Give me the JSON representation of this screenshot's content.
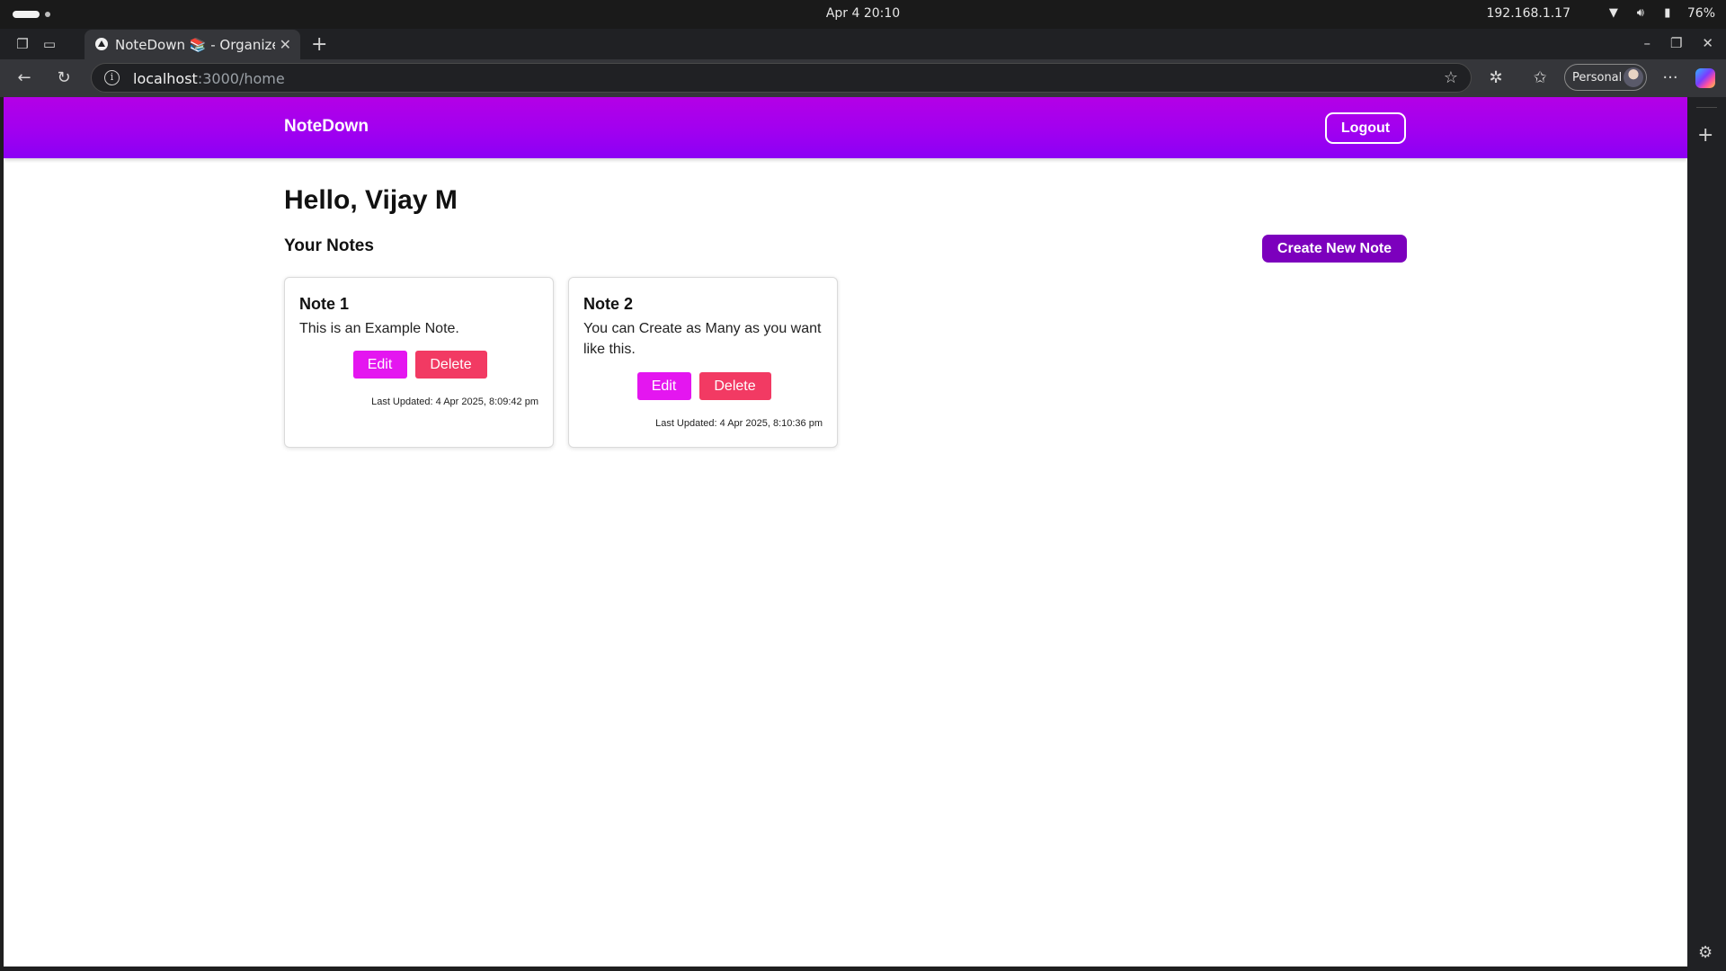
{
  "os": {
    "clock": "Apr 4  20:10",
    "ip": "192.168.1.17",
    "battery": "76%",
    "icons": [
      "wifi-icon",
      "volume-icon",
      "battery-icon"
    ]
  },
  "browser": {
    "tab_title": "NoteDown 📚 - Organize Y",
    "url_host": "localhost",
    "url_path": ":3000/home",
    "profile_label": "Personal"
  },
  "app": {
    "brand": "NoteDown",
    "logout_label": "Logout",
    "greeting": "Hello, Vijay M",
    "section_title": "Your Notes",
    "create_label": "Create New Note",
    "accent_colors": {
      "navbar": "#a100f0",
      "create_button": "#7c00bd",
      "edit_button": "#e416f0",
      "delete_button": "#f23a63"
    },
    "notes": [
      {
        "title": "Note 1",
        "body": "This is an Example Note.",
        "edit_label": "Edit",
        "delete_label": "Delete",
        "updated": "Last Updated: 4 Apr 2025, 8:09:42 pm"
      },
      {
        "title": "Note 2",
        "body": "You can Create as Many as you want like this.",
        "edit_label": "Edit",
        "delete_label": "Delete",
        "updated": "Last Updated: 4 Apr 2025, 8:10:36 pm"
      }
    ]
  }
}
